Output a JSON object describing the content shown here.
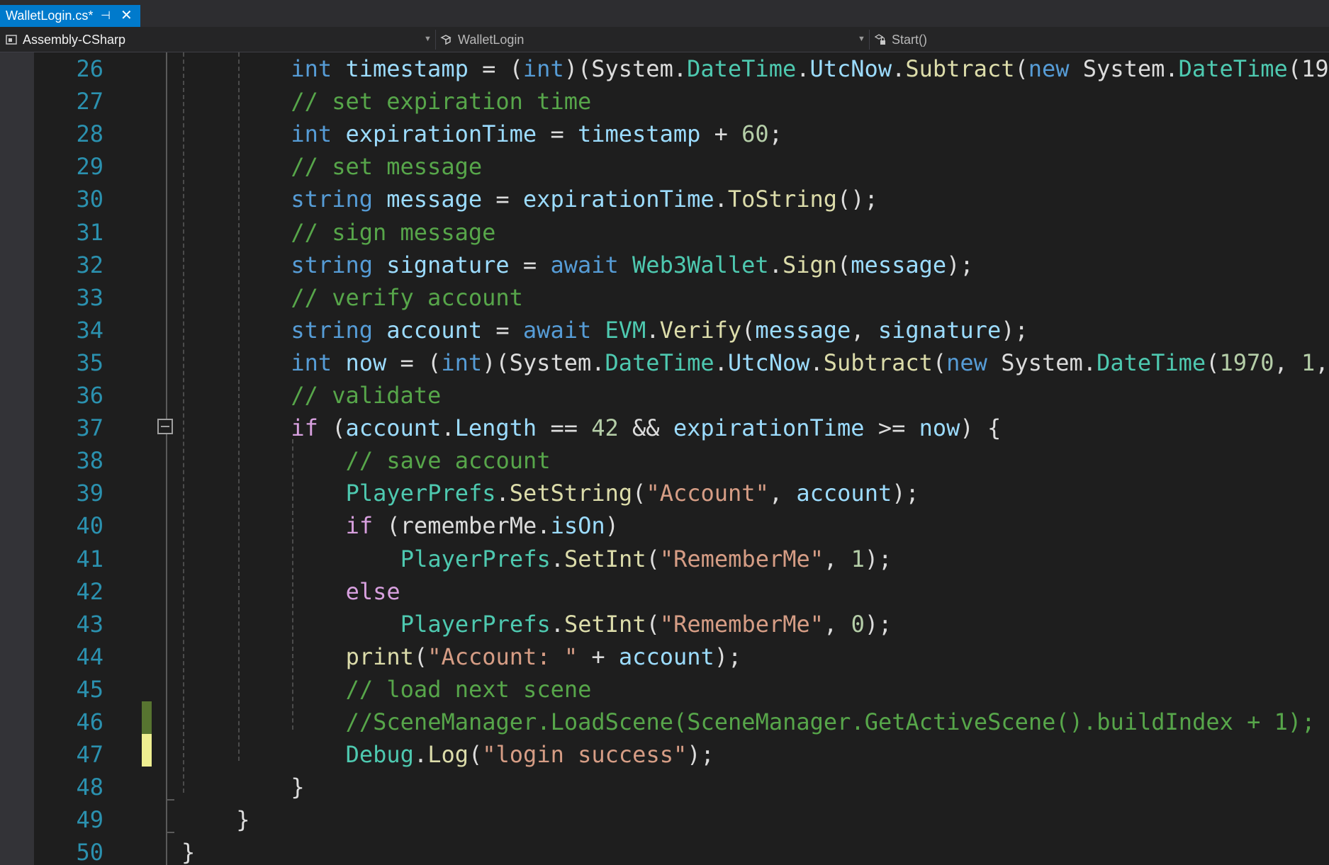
{
  "tab": {
    "title": "WalletLogin.cs*",
    "pin_glyph": "⊣",
    "close_glyph": "✕"
  },
  "navbar": {
    "project": "Assembly-CSharp",
    "class": "WalletLogin",
    "member": "Start()"
  },
  "editor": {
    "line_numbers": [
      "26",
      "27",
      "28",
      "29",
      "30",
      "31",
      "32",
      "33",
      "34",
      "35",
      "36",
      "37",
      "38",
      "39",
      "40",
      "41",
      "42",
      "43",
      "44",
      "45",
      "46",
      "47",
      "48",
      "49",
      "50"
    ],
    "colors": {
      "keyword": "#569cd6",
      "control": "#d8a0df",
      "type": "#4ec9b0",
      "method": "#dcdcaa",
      "variable": "#9cdcfe",
      "string": "#d69d85",
      "number": "#b5cea8",
      "comment": "#57a64a",
      "line_number": "#2b91af",
      "saved_change": "#577430",
      "unsaved_change": "#efef91"
    },
    "lines": [
      [
        [
          "k",
          "int"
        ],
        [
          "p",
          " "
        ],
        [
          "v",
          "timestamp"
        ],
        [
          "p",
          " = ("
        ],
        [
          "k",
          "int"
        ],
        [
          "p",
          ")(System."
        ],
        [
          "t",
          "DateTime"
        ],
        [
          "p",
          "."
        ],
        [
          "v",
          "UtcNow"
        ],
        [
          "p",
          "."
        ],
        [
          "m",
          "Subtract"
        ],
        [
          "p",
          "("
        ],
        [
          "k",
          "new"
        ],
        [
          "p",
          " System."
        ],
        [
          "t",
          "DateTime"
        ],
        [
          "p",
          "(19"
        ]
      ],
      [
        [
          "c",
          "// set expiration time"
        ]
      ],
      [
        [
          "k",
          "int"
        ],
        [
          "p",
          " "
        ],
        [
          "v",
          "expirationTime"
        ],
        [
          "p",
          " = "
        ],
        [
          "v",
          "timestamp"
        ],
        [
          "p",
          " + "
        ],
        [
          "n",
          "60"
        ],
        [
          "p",
          ";"
        ]
      ],
      [
        [
          "c",
          "// set message"
        ]
      ],
      [
        [
          "k",
          "string"
        ],
        [
          "p",
          " "
        ],
        [
          "v",
          "message"
        ],
        [
          "p",
          " = "
        ],
        [
          "v",
          "expirationTime"
        ],
        [
          "p",
          "."
        ],
        [
          "m",
          "ToString"
        ],
        [
          "p",
          "();"
        ]
      ],
      [
        [
          "c",
          "// sign message"
        ]
      ],
      [
        [
          "k",
          "string"
        ],
        [
          "p",
          " "
        ],
        [
          "v",
          "signature"
        ],
        [
          "p",
          " = "
        ],
        [
          "k",
          "await"
        ],
        [
          "p",
          " "
        ],
        [
          "t",
          "Web3Wallet"
        ],
        [
          "p",
          "."
        ],
        [
          "m",
          "Sign"
        ],
        [
          "p",
          "("
        ],
        [
          "v",
          "message"
        ],
        [
          "p",
          ");"
        ]
      ],
      [
        [
          "c",
          "// verify account"
        ]
      ],
      [
        [
          "k",
          "string"
        ],
        [
          "p",
          " "
        ],
        [
          "v",
          "account"
        ],
        [
          "p",
          " = "
        ],
        [
          "k",
          "await"
        ],
        [
          "p",
          " "
        ],
        [
          "t",
          "EVM"
        ],
        [
          "p",
          "."
        ],
        [
          "m",
          "Verify"
        ],
        [
          "p",
          "("
        ],
        [
          "v",
          "message"
        ],
        [
          "p",
          ", "
        ],
        [
          "v",
          "signature"
        ],
        [
          "p",
          ");"
        ]
      ],
      [
        [
          "k",
          "int"
        ],
        [
          "p",
          " "
        ],
        [
          "v",
          "now"
        ],
        [
          "p",
          " = ("
        ],
        [
          "k",
          "int"
        ],
        [
          "p",
          ")(System."
        ],
        [
          "t",
          "DateTime"
        ],
        [
          "p",
          "."
        ],
        [
          "v",
          "UtcNow"
        ],
        [
          "p",
          "."
        ],
        [
          "m",
          "Subtract"
        ],
        [
          "p",
          "("
        ],
        [
          "k",
          "new"
        ],
        [
          "p",
          " System."
        ],
        [
          "t",
          "DateTime"
        ],
        [
          "p",
          "("
        ],
        [
          "n",
          "1970"
        ],
        [
          "p",
          ", "
        ],
        [
          "n",
          "1"
        ],
        [
          "p",
          ","
        ]
      ],
      [
        [
          "c",
          "// validate"
        ]
      ],
      [
        [
          "k2",
          "if"
        ],
        [
          "p",
          " ("
        ],
        [
          "v",
          "account"
        ],
        [
          "p",
          "."
        ],
        [
          "v",
          "Length"
        ],
        [
          "p",
          " == "
        ],
        [
          "n",
          "42"
        ],
        [
          "p",
          " && "
        ],
        [
          "v",
          "expirationTime"
        ],
        [
          "p",
          " >= "
        ],
        [
          "v",
          "now"
        ],
        [
          "p",
          ") {"
        ]
      ],
      [
        [
          "c",
          "// save account"
        ]
      ],
      [
        [
          "t",
          "PlayerPrefs"
        ],
        [
          "p",
          "."
        ],
        [
          "m",
          "SetString"
        ],
        [
          "p",
          "("
        ],
        [
          "s",
          "\"Account\""
        ],
        [
          "p",
          ", "
        ],
        [
          "v",
          "account"
        ],
        [
          "p",
          ");"
        ]
      ],
      [
        [
          "k2",
          "if"
        ],
        [
          "p",
          " (rememberMe."
        ],
        [
          "v",
          "isOn"
        ],
        [
          "p",
          ")"
        ]
      ],
      [
        [
          "t",
          "PlayerPrefs"
        ],
        [
          "p",
          "."
        ],
        [
          "m",
          "SetInt"
        ],
        [
          "p",
          "("
        ],
        [
          "s",
          "\"RememberMe\""
        ],
        [
          "p",
          ", "
        ],
        [
          "n",
          "1"
        ],
        [
          "p",
          ");"
        ]
      ],
      [
        [
          "k2",
          "else"
        ]
      ],
      [
        [
          "t",
          "PlayerPrefs"
        ],
        [
          "p",
          "."
        ],
        [
          "m",
          "SetInt"
        ],
        [
          "p",
          "("
        ],
        [
          "s",
          "\"RememberMe\""
        ],
        [
          "p",
          ", "
        ],
        [
          "n",
          "0"
        ],
        [
          "p",
          ");"
        ]
      ],
      [
        [
          "m",
          "print"
        ],
        [
          "p",
          "("
        ],
        [
          "s",
          "\"Account: \""
        ],
        [
          "p",
          " + "
        ],
        [
          "v",
          "account"
        ],
        [
          "p",
          ");"
        ]
      ],
      [
        [
          "c",
          "// load next scene"
        ]
      ],
      [
        [
          "c",
          "//SceneManager.LoadScene(SceneManager.GetActiveScene().buildIndex + 1);"
        ]
      ],
      [
        [
          "t",
          "Debug"
        ],
        [
          "p",
          "."
        ],
        [
          "m",
          "Log"
        ],
        [
          "p",
          "("
        ],
        [
          "s",
          "\"login success\""
        ],
        [
          "p",
          ");"
        ]
      ],
      [
        [
          "p",
          "}"
        ]
      ],
      [
        [
          "p",
          "}"
        ]
      ],
      [
        [
          "p",
          "}"
        ]
      ]
    ]
  }
}
